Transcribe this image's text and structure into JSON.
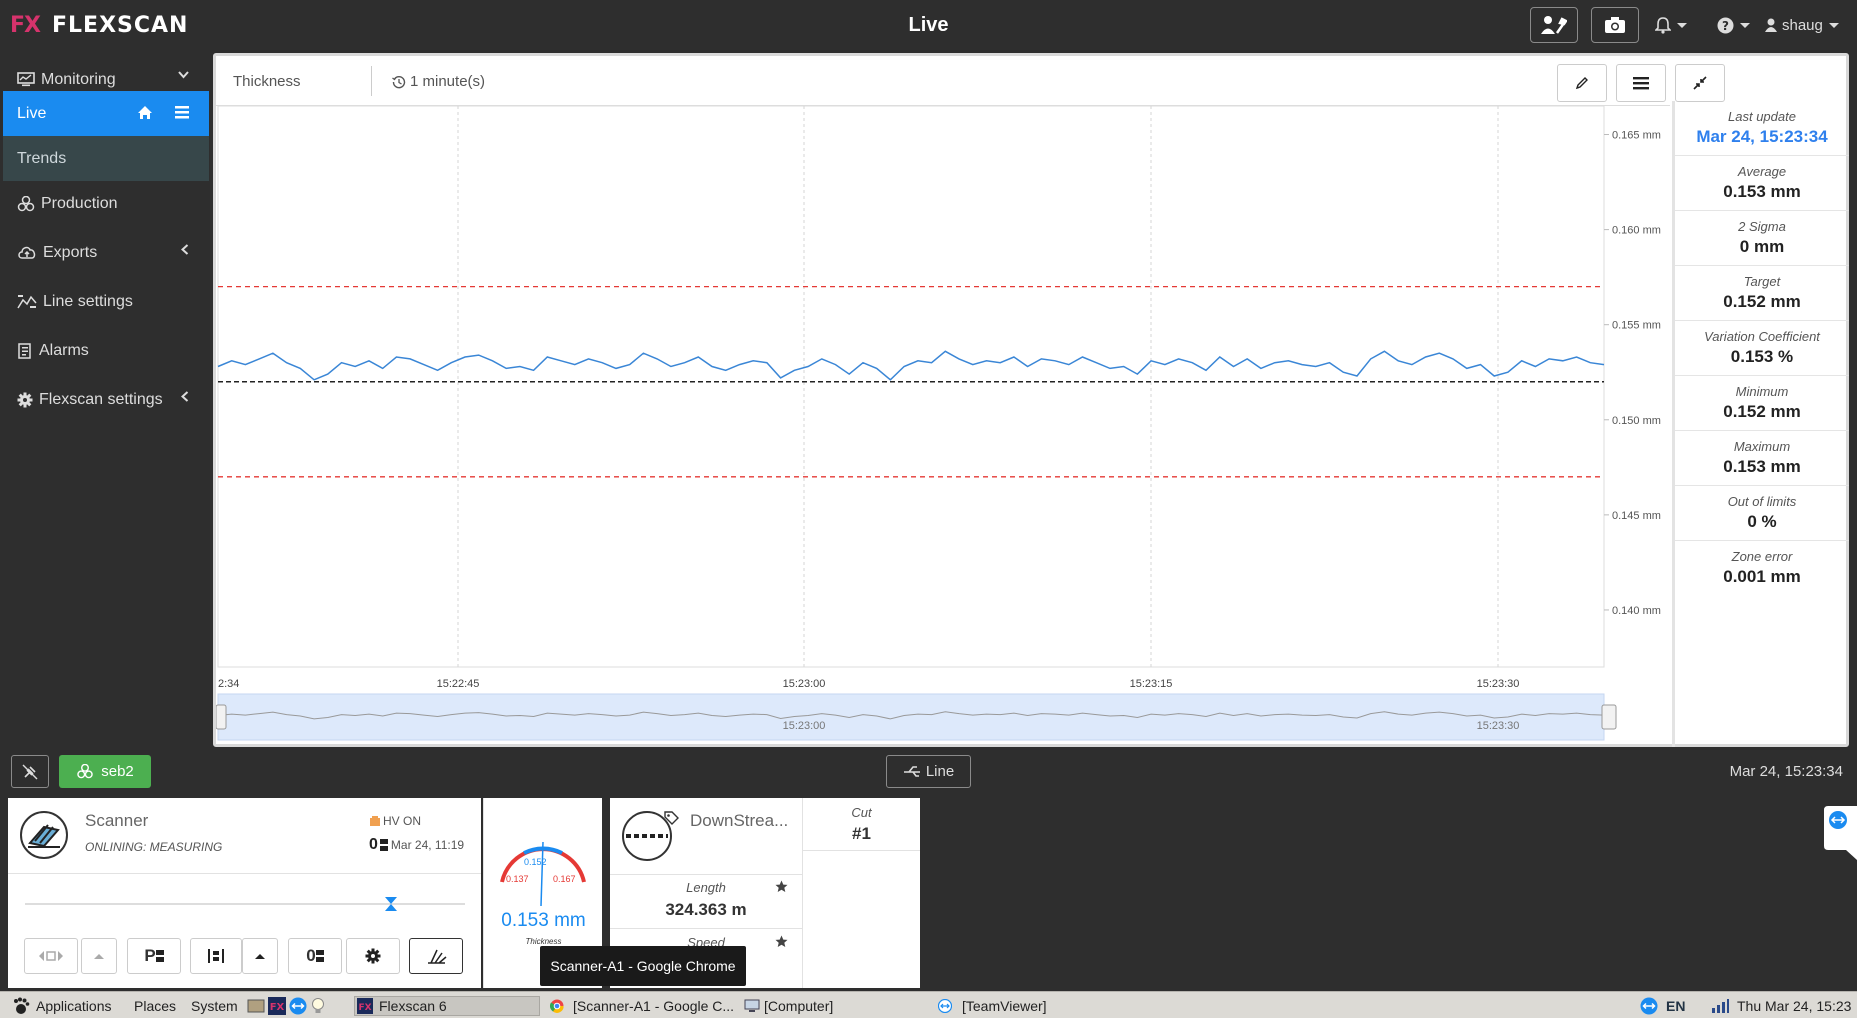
{
  "app": {
    "logo_fx": "FX",
    "logo_name": "FLEXSCAN",
    "page_title": "Live",
    "user": "shaug"
  },
  "sidebar": {
    "items": [
      {
        "label": "Monitoring"
      },
      {
        "label": "Live"
      },
      {
        "label": "Trends"
      },
      {
        "label": "Production"
      },
      {
        "label": "Exports"
      },
      {
        "label": "Line settings"
      },
      {
        "label": "Alarms"
      },
      {
        "label": "Flexscan settings"
      }
    ]
  },
  "chart_header": {
    "title": "Thickness",
    "period": "1 minute(s)"
  },
  "chart_data": {
    "type": "line",
    "title": "",
    "xlabel": "",
    "ylabel": "",
    "x_ticks": [
      "2:34",
      "15:22:45",
      "15:23:00",
      "15:23:15",
      "15:23:30"
    ],
    "y_ticks": [
      "0.165 mm",
      "0.160 mm",
      "0.155 mm",
      "0.150 mm",
      "0.145 mm",
      "0.140 mm"
    ],
    "ylim": [
      0.137,
      0.1665
    ],
    "navigator_labels": [
      "15:23:00",
      "15:23:30"
    ],
    "target": 0.152,
    "upper_limit": 0.157,
    "lower_limit": 0.147,
    "series": [
      {
        "values": [
          0.1528,
          0.1531,
          0.1529,
          0.1532,
          0.1535,
          0.153,
          0.1527,
          0.1521,
          0.1524,
          0.153,
          0.1528,
          0.1531,
          0.1527,
          0.1533,
          0.1532,
          0.1529,
          0.1526,
          0.153,
          0.1533,
          0.1534,
          0.1531,
          0.1527,
          0.1528,
          0.1526,
          0.1533,
          0.1531,
          0.1529,
          0.1532,
          0.153,
          0.1527,
          0.1529,
          0.1535,
          0.1532,
          0.1528,
          0.153,
          0.1533,
          0.1528,
          0.1526,
          0.1529,
          0.1531,
          0.153,
          0.1522,
          0.1526,
          0.1528,
          0.1532,
          0.1529,
          0.1524,
          0.153,
          0.1527,
          0.1521,
          0.1528,
          0.1531,
          0.153,
          0.1536,
          0.1532,
          0.1529,
          0.1531,
          0.153,
          0.1533,
          0.1528,
          0.1532,
          0.1531,
          0.1529,
          0.1533,
          0.153,
          0.1527,
          0.1528,
          0.1524,
          0.1531,
          0.1529,
          0.1532,
          0.153,
          0.1526,
          0.1533,
          0.1528,
          0.1532,
          0.1527,
          0.153,
          0.1531,
          0.1529,
          0.1528,
          0.153,
          0.1525,
          0.1523,
          0.1532,
          0.1536,
          0.1531,
          0.1529,
          0.1533,
          0.1535,
          0.1532,
          0.1527,
          0.1529,
          0.1523,
          0.1525,
          0.1531,
          0.1528,
          0.1532,
          0.1531,
          0.1533,
          0.153,
          0.1529
        ]
      }
    ]
  },
  "stats": [
    {
      "label": "Last update",
      "value": "Mar 24, 15:23:34"
    },
    {
      "label": "Average",
      "value": "0.153 mm"
    },
    {
      "label": "2 Sigma",
      "value": "0 mm"
    },
    {
      "label": "Target",
      "value": "0.152 mm"
    },
    {
      "label": "Variation Coefficient",
      "value": "0.153 %"
    },
    {
      "label": "Minimum",
      "value": "0.152 mm"
    },
    {
      "label": "Maximum",
      "value": "0.153 mm"
    },
    {
      "label": "Out of limits",
      "value": "0 %"
    },
    {
      "label": "Zone error",
      "value": "0.001 mm"
    }
  ],
  "status": {
    "profile_button": "seb2",
    "line_button": "Line",
    "datetime": "Mar 24, 15:23:34"
  },
  "scanner": {
    "title": "Scanner",
    "state": "ONLINING: MEASURING",
    "hv": "HV ON",
    "zero_date": "Mar 24, 11:19",
    "gauge_target": "0.152",
    "gauge_low": "0.137",
    "gauge_high": "0.167",
    "gauge_value": "0.153 mm",
    "gauge_label": "Thickness"
  },
  "downstream": {
    "title": "DownStrea...",
    "cut_label": "Cut",
    "cut_value": "#1",
    "length_label": "Length",
    "length_value": "324.363 m",
    "speed_label": "Speed"
  },
  "tooltip": "Scanner-A1 - Google Chrome",
  "taskbar": {
    "applications": "Applications",
    "places": "Places",
    "system": "System",
    "task_flexscan": "Flexscan 6",
    "task_chrome": "[Scanner-A1 - Google C...",
    "task_computer": "[Computer]",
    "task_teamviewer": "[TeamViewer]",
    "lang": "EN",
    "clock": "Thu Mar 24, 15:23"
  },
  "colors": {
    "accent": "#1a8bf0",
    "series": "#3a86d6",
    "limit": "#e53935",
    "target": "#222222",
    "profile_btn": "#4caf50"
  }
}
